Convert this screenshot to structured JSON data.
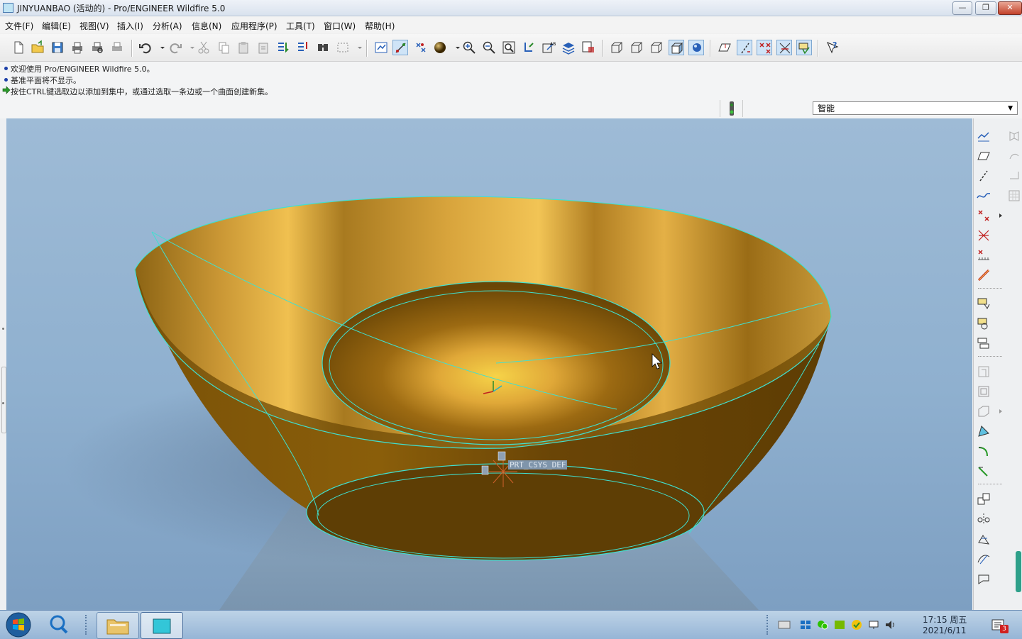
{
  "window": {
    "title": "JINYUANBAO (活动的) - Pro/ENGINEER Wildfire 5.0",
    "controls": {
      "minimize": "—",
      "maximize": "❐",
      "close": "✕"
    }
  },
  "menu": {
    "items": [
      {
        "label": "文件(F)"
      },
      {
        "label": "编辑(E)"
      },
      {
        "label": "视图(V)"
      },
      {
        "label": "插入(I)"
      },
      {
        "label": "分析(A)"
      },
      {
        "label": "信息(N)"
      },
      {
        "label": "应用程序(P)"
      },
      {
        "label": "工具(T)"
      },
      {
        "label": "窗口(W)"
      },
      {
        "label": "帮助(H)"
      }
    ]
  },
  "messages": [
    {
      "text": "欢迎使用 Pro/ENGINEER Wildfire 5.0。",
      "icon": "bullet-dot-icon"
    },
    {
      "text": "基准平面将不显示。",
      "icon": "bullet-dot-icon"
    },
    {
      "text": "按住CTRL键选取边以添加到集中，或通过选取一条边或一个曲面创建新集。",
      "icon": "arrow-prompt-icon"
    }
  ],
  "filter": {
    "selected": "智能"
  },
  "model": {
    "csys_label": "PRT_CSYS_DEF",
    "colors": {
      "gold_light": "#f0c050",
      "gold_mid": "#c89020",
      "gold_dark": "#6e4a06",
      "edge": "#40e0d0"
    }
  },
  "taskbar": {
    "time": "17:15 周五",
    "date": "2021/6/11",
    "notification_count": "3"
  },
  "colors": {
    "viewport_bg": "#8fb0cf",
    "accent": "#1c3fa8"
  }
}
